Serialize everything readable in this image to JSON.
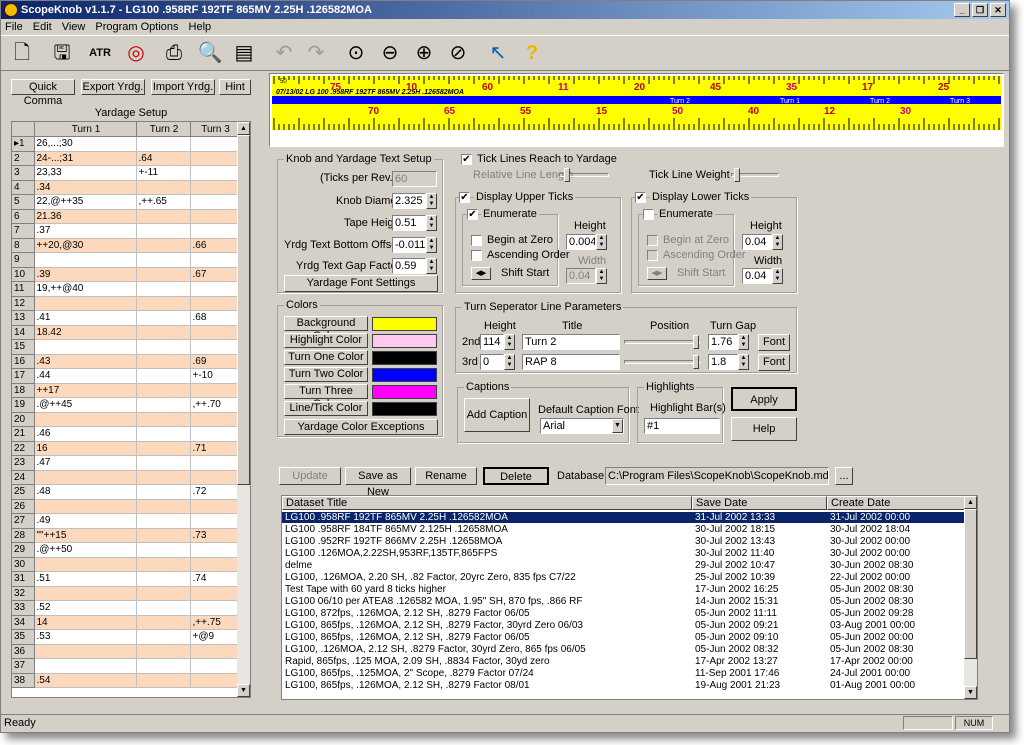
{
  "window": {
    "title": "ScopeKnob v1.1.7 - LG100 .958RF 192TF 865MV 2.25H .126582MOA",
    "min": "_",
    "max": "❐",
    "close": "✕"
  },
  "menu": [
    "File",
    "Edit",
    "View",
    "Program Options",
    "Help"
  ],
  "toolbar": {
    "icons": [
      "new-icon",
      "save-icon",
      "atrag-icon",
      "target-icon",
      "print-icon",
      "print-preview-icon",
      "properties-icon",
      "undo-icon",
      "redo-icon",
      "zoom-fit-icon",
      "zoom-out-icon",
      "zoom-in-icon",
      "zoom-reset-icon",
      "whats-this-icon",
      "help-icon"
    ]
  },
  "left": {
    "buttons": [
      "Quick Comma",
      "Export Yrdg.",
      "Import Yrdg.",
      "Hint"
    ],
    "title": "Yardage Setup",
    "columns": [
      "Turn 1",
      "Turn 2",
      "Turn 3"
    ],
    "rows": [
      [
        "26,...;30",
        "",
        ""
      ],
      [
        "24-...;31",
        ".64",
        ""
      ],
      [
        "23,33",
        "+-11",
        ""
      ],
      [
        ".34",
        "",
        ""
      ],
      [
        "22,@++35",
        ",++.65",
        ""
      ],
      [
        "21.36",
        "",
        ""
      ],
      [
        ".37",
        "",
        ""
      ],
      [
        "++20,@30",
        "",
        ".66"
      ],
      [
        "",
        "",
        ""
      ],
      [
        ".39",
        "",
        ".67"
      ],
      [
        "19,++@40",
        "",
        ""
      ],
      [
        "",
        "",
        ""
      ],
      [
        ".41",
        "",
        ".68"
      ],
      [
        "18.42",
        "",
        ""
      ],
      [
        "",
        "",
        ""
      ],
      [
        ".43",
        "",
        ".69"
      ],
      [
        ".44",
        "",
        "+-10"
      ],
      [
        "++17",
        "",
        ""
      ],
      [
        ".@++45",
        "",
        ",++.70"
      ],
      [
        "",
        "",
        ""
      ],
      [
        ".46",
        "",
        ""
      ],
      [
        "16",
        "",
        ".71"
      ],
      [
        ".47",
        "",
        ""
      ],
      [
        "",
        "",
        ""
      ],
      [
        ".48",
        "",
        ".72"
      ],
      [
        "",
        "",
        ""
      ],
      [
        ".49",
        "",
        ""
      ],
      [
        "\"\"++15",
        "",
        ".73"
      ],
      [
        ".@++50",
        "",
        ""
      ],
      [
        "",
        "",
        ""
      ],
      [
        ".51",
        "",
        ".74"
      ],
      [
        "",
        "",
        ""
      ],
      [
        ".52",
        "",
        ""
      ],
      [
        "14",
        "",
        ",++.75"
      ],
      [
        ".53",
        "",
        "+@9"
      ],
      [
        "",
        "",
        ""
      ],
      [
        "",
        "",
        ""
      ],
      [
        ".54",
        "",
        ""
      ]
    ]
  },
  "ruler": {
    "top_row": "50",
    "turn_labels": [
      "Turn 2",
      "Turn 1",
      "Turn 2",
      "Turn 3"
    ],
    "red_numbers": [
      "75",
      "70",
      "10",
      "65",
      "60",
      "55",
      "11",
      "15",
      "20",
      "50",
      "45",
      "40",
      "35",
      "12",
      "17",
      "30",
      "25"
    ],
    "band_text": "07/13/02 LG 100 .958RF 192TF 865MV 2.25H .126582MOA"
  },
  "knob": {
    "title": "Knob and Yardage Text Setup",
    "ticks_label": "(Ticks per Rev.)",
    "ticks_value": "60",
    "diameter_label": "Knob Diameter",
    "diameter_value": "2.325",
    "tape_label": "Tape Height",
    "tape_value": "0.51",
    "bottom_label": "Yrdg Text Bottom Offset",
    "bottom_value": "-0.011",
    "gap_label": "Yrdg Text Gap Factor",
    "gap_value": "0.59",
    "font_button": "Yardage Font Settings"
  },
  "ticks": {
    "reach": "Tick Lines Reach to Yardage",
    "rel_length": "Relative Line Length",
    "weight": "Tick Line Weight",
    "upper": "Display Upper Ticks",
    "lower": "Display Lower Ticks",
    "enumerate": "Enumerate",
    "begin": "Begin at Zero",
    "ascending": "Ascending Order",
    "shift": "Shift Start",
    "height": "Height",
    "width": "Width",
    "upper_h": "0.004",
    "upper_w": "0.04",
    "lower_h": "0.04",
    "lower_w": "0.04"
  },
  "colors": {
    "title": "Colors",
    "items": [
      {
        "label": "Background Color",
        "color": "#ffff00"
      },
      {
        "label": "Highlight Color",
        "color": "#ffc8f0"
      },
      {
        "label": "Turn One Color",
        "color": "#000000"
      },
      {
        "label": "Turn Two Color",
        "color": "#0000ff"
      },
      {
        "label": "Turn Three Color",
        "color": "#ff00ff"
      },
      {
        "label": "Line/Tick Color",
        "color": "#000000"
      }
    ],
    "exceptions": "Yardage Color Exceptions"
  },
  "sep": {
    "title": "Turn Seperator Line Parameters",
    "h_height": "Height",
    "h_title": "Title",
    "h_position": "Position",
    "h_gap": "Turn Gap",
    "r2": "2nd",
    "r2_h": "114",
    "r2_t": "Turn 2",
    "r2_g": "1.76",
    "r3": "3rd",
    "r3_h": "0",
    "r3_t": "RAP 8",
    "r3_g": "1.8",
    "font": "Font"
  },
  "captions": {
    "title": "Captions",
    "add": "Add Caption",
    "default_font": "Default Caption Font",
    "font_value": "Arial"
  },
  "highlights": {
    "title": "Highlights",
    "label": "Highlight Bar(s)",
    "value": "#1"
  },
  "apply": "Apply",
  "help": "Help",
  "db": {
    "update": "Update",
    "save_as": "Save as New",
    "rename": "Rename",
    "delete": "Delete",
    "label": "Database",
    "path": "C:\\Program Files\\ScopeKnob\\ScopeKnob.mdb",
    "browse": "..."
  },
  "list": {
    "cols": [
      "Dataset Title",
      "Save Date",
      "Create Date"
    ],
    "rows": [
      [
        "LG100 .958RF 192TF 865MV 2.25H .126582MOA",
        "31-Jul 2002 13:33",
        "31-Jul 2002 00:00"
      ],
      [
        "LG100 .958RF 184TF 865MV 2.125H .12658MOA",
        "30-Jul 2002 18:15",
        "30-Jul 2002 18:04"
      ],
      [
        "LG100 .952RF 192TF 866MV 2.25H .12658MOA",
        "30-Jul 2002 13:43",
        "30-Jul 2002 00:00"
      ],
      [
        "LG100 .126MOA,2.22SH,953RF,135TF,865FPS",
        "30-Jul 2002 11:40",
        "30-Jul 2002 00:00"
      ],
      [
        "delme",
        "29-Jul 2002 10:47",
        "30-Jun 2002 08:30"
      ],
      [
        "LG100, .126MOA, 2.20 SH, .82 Factor, 20yrc Zero, 835 fps C7/22",
        "25-Jul 2002 10:39",
        "22-Jul 2002 00:00"
      ],
      [
        "Test Tape with 60 yard 8 ticks higher",
        "17-Jun 2002 16:25",
        "05-Jun 2002 08:30"
      ],
      [
        "LG100 06/10 per ATEA8 .126582 MOA, 1.95\" SH, 870 fps, .866 RF",
        "14-Jun 2002 15:31",
        "05-Jun 2002 08:30"
      ],
      [
        "LG100, 872fps, .126MOA, 2.12 SH, .8279 Factor 06/05",
        "05-Jun 2002 11:11",
        "05-Jun 2002 09:28"
      ],
      [
        "LG100, 865fps, .126MOA, 2.12 SH, .8279 Factor, 30yrd Zero 06/03",
        "05-Jun 2002 09:21",
        "03-Aug 2001 00:00"
      ],
      [
        "LG100, 865fps, .126MOA, 2.12 SH, .8279 Factor 06/05",
        "05-Jun 2002 09:10",
        "05-Jun 2002 00:00"
      ],
      [
        "LG100, .126MOA, 2.12 SH, .8279 Factor, 30yrd Zero, 865 fps 06/05",
        "05-Jun 2002 08:32",
        "05-Jun 2002 08:30"
      ],
      [
        "Rapid, 865fps, .125 MOA, 2.09 SH, .8834 Factor, 30yd zero",
        "17-Apr 2002 13:27",
        "17-Apr 2002 00:00"
      ],
      [
        "LG100, 865fps, .125MOA, 2\" Scope, .8279 Factor 07/24",
        "11-Sep 2001 17:46",
        "24-Jul 2001 00:00"
      ],
      [
        "LG100, 865fps, .126MOA, 2.12 SH, .8279 Factor 08/01",
        "19-Aug 2001 21:23",
        "01-Aug 2001 00:00"
      ]
    ]
  },
  "status": {
    "text": "Ready",
    "num": "NUM"
  }
}
